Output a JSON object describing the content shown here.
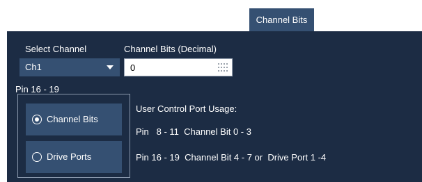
{
  "tab": {
    "label": "Channel Bits"
  },
  "select_channel": {
    "label": "Select Channel",
    "value": "Ch1"
  },
  "channel_bits_decimal": {
    "label": "Channel Bits (Decimal)",
    "value": "0"
  },
  "pin_group": {
    "label": "Pin 16 - 19",
    "options": [
      {
        "label": "Channel Bits",
        "selected": true
      },
      {
        "label": "Drive Ports",
        "selected": false
      }
    ]
  },
  "usage": {
    "title": "User Control Port Usage:",
    "line1": "Pin   8 - 11  Channel Bit 0 - 3",
    "line2": "Pin 16 - 19  Channel Bit 4 - 7 or  Drive Port 1 -4"
  },
  "colors": {
    "panel_bg": "#1c2c44",
    "control_bg": "#355072",
    "text": "#ffffff"
  },
  "icons": {
    "dropdown": "chevron-down-icon",
    "keypad": "keypad-icon",
    "radio_checked": "radio-checked-icon",
    "radio_unchecked": "radio-unchecked-icon"
  }
}
